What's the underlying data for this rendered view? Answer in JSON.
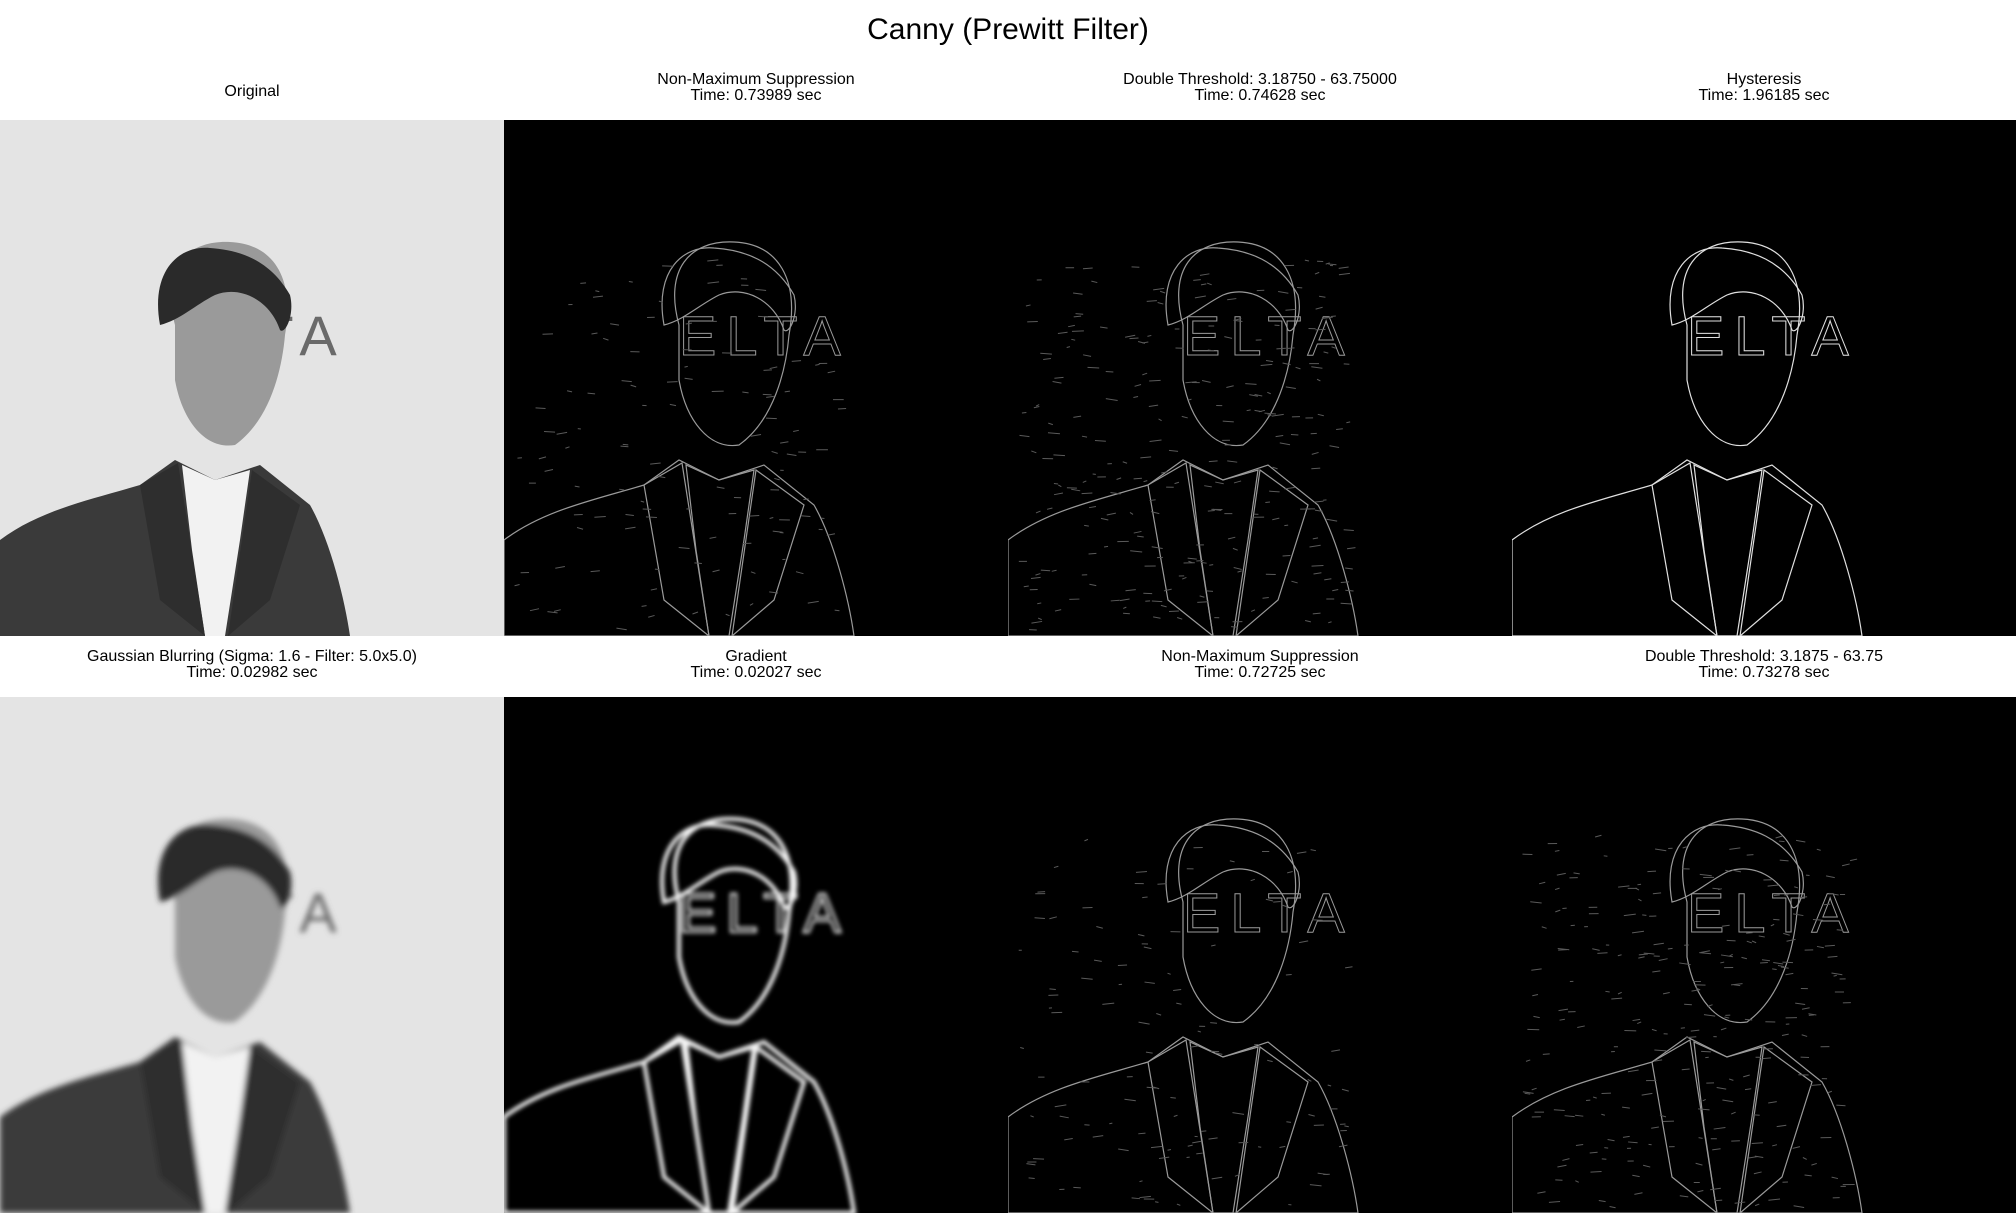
{
  "figure": {
    "title": "Canny (Prewitt Filter)"
  },
  "panels": [
    {
      "line1": "Original",
      "line2": "",
      "kind": "original"
    },
    {
      "line1": "Non-Maximum Suppression",
      "line2": "Time: 0.73989 sec",
      "kind": "edges-thin"
    },
    {
      "line1": "Double Threshold: 3.18750 - 63.75000",
      "line2": "Time: 0.74628 sec",
      "kind": "edges-noisy"
    },
    {
      "line1": "Hysteresis",
      "line2": "Time: 1.96185 sec",
      "kind": "edges-final"
    },
    {
      "line1": "Gaussian Blurring (Sigma: 1.6 - Filter: 5.0x5.0)",
      "line2": "Time: 0.02982 sec",
      "kind": "blurred"
    },
    {
      "line1": "Gradient",
      "line2": "Time: 0.02027 sec",
      "kind": "gradient"
    },
    {
      "line1": "Non-Maximum Suppression",
      "line2": "Time: 0.72725 sec",
      "kind": "edges-thin"
    },
    {
      "line1": "Double Threshold: 3.1875 - 63.75",
      "line2": "Time: 0.73278 sec",
      "kind": "edges-noisy"
    }
  ],
  "image_text": {
    "sign": "ELTA"
  },
  "colors": {
    "background": "#ffffff",
    "edge_bg": "#000000",
    "photo_bg": "#e4e4e4",
    "suit": "#3a3a3a",
    "shirt": "#f2f2f2",
    "skin": "#9a9a9a",
    "hair": "#2a2a2a"
  }
}
